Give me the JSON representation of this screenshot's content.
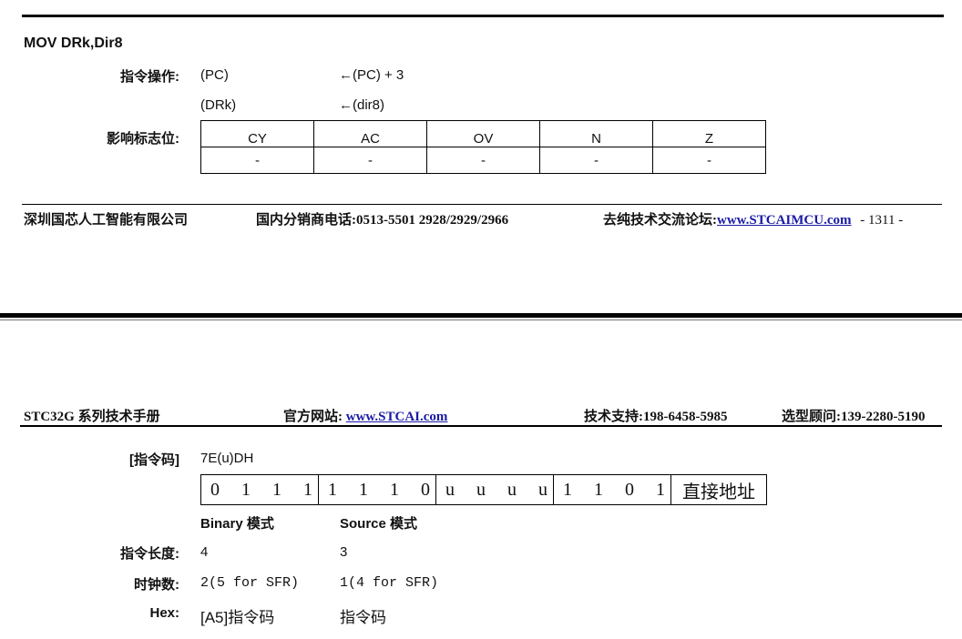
{
  "instruction": {
    "title": "MOV DRk,Dir8",
    "operation_label": "指令操作:",
    "operations": [
      {
        "dest": "(PC)",
        "src": "←(PC) + 3"
      },
      {
        "dest": "(DRk)",
        "src": "←(dir8)"
      }
    ],
    "flags_label": "影响标志位:",
    "flags": {
      "headers": [
        "CY",
        "AC",
        "OV",
        "N",
        "Z"
      ],
      "values": [
        "-",
        "-",
        "-",
        "-",
        "-"
      ]
    }
  },
  "footer": {
    "company": "深圳国芯人工智能有限公司",
    "distributor_label": "国内分销商电话:",
    "distributor_phone": "0513-5501 2928/2929/2966",
    "forum_label": "去纯技术交流论坛:",
    "forum_url": "www.STCAIMCU.com",
    "page_number": "- 1311 -"
  },
  "header": {
    "manual": "STC32G 系列技术手册",
    "site_label": "官方网站:",
    "site_url": "www.STCAI.com",
    "support_label": "技术支持:",
    "support_phone": "198-6458-5985",
    "consult_label": "选型顾问:",
    "consult_phone": "139-2280-5190"
  },
  "encoding": {
    "opcode_label": "[指令码]",
    "opcode": "7E(u)DH",
    "bit_groups": [
      [
        "0",
        "1",
        "1",
        "1"
      ],
      [
        "1",
        "1",
        "1",
        "0"
      ],
      [
        "u",
        "u",
        "u",
        "u"
      ],
      [
        "1",
        "1",
        "0",
        "1"
      ]
    ],
    "address_cell": "直接地址",
    "binary_mode": "Binary 模式",
    "source_mode": "Source 模式",
    "length_label": "指令长度:",
    "length_binary": "4",
    "length_source": "3",
    "clock_label": "时钟数:",
    "clock_binary": "2(5 for SFR)",
    "clock_source": "1(4 for SFR)",
    "hex_label": "Hex:",
    "hex_binary": "[A5]指令码",
    "hex_source": "指令码"
  }
}
